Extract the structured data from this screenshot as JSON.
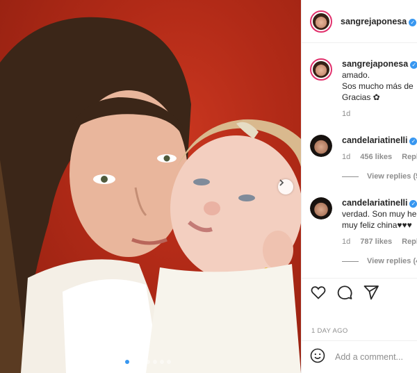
{
  "post": {
    "author": "sangrejaponesa",
    "verified": true,
    "carousel": {
      "slide_count": 7,
      "active_index": 0
    }
  },
  "comments": [
    {
      "username": "sangrejaponesa",
      "verified": true,
      "text_lines": [
        "amado.",
        "Sos mucho más de",
        "Gracias ✿"
      ],
      "time": "1d"
    },
    {
      "username": "candelariatinelli",
      "verified": true,
      "text_lines": [],
      "time": "1d",
      "likes": "456 likes",
      "reply": "Reply",
      "view_replies": "View replies (5"
    },
    {
      "username": "candelariatinelli",
      "verified": true,
      "text_lines": [
        "verdad. Son muy he",
        "muy feliz china♥♥♥"
      ],
      "time": "1d",
      "likes": "787 likes",
      "reply": "Reply",
      "view_replies": "View replies (4"
    }
  ],
  "timeago": "1 DAY AGO",
  "add_comment": {
    "placeholder": "Add a comment..."
  },
  "colors": {
    "verified": "#3897f0",
    "text": "#262626",
    "muted": "#8e8e8e"
  },
  "icons": [
    "heart-icon",
    "comment-icon",
    "share-icon",
    "emoji-icon",
    "chevron-right-icon",
    "verified-icon"
  ]
}
